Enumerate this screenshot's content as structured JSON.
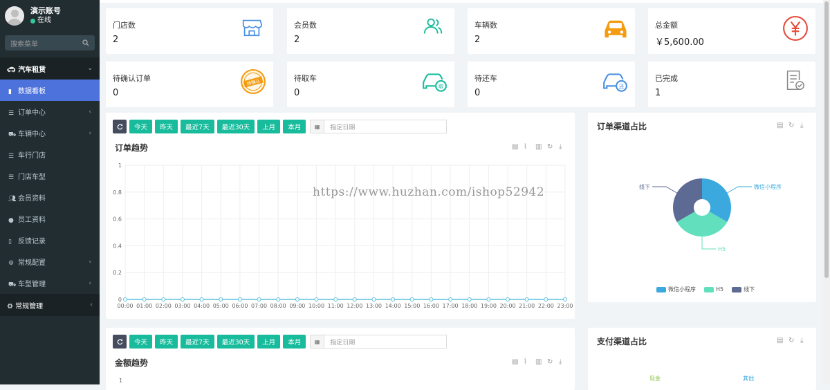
{
  "user": {
    "name": "演示账号",
    "status": "在线"
  },
  "search": {
    "placeholder": "搜索菜单"
  },
  "menu": {
    "group1": "汽车租赁",
    "items": [
      {
        "label": "数据看板",
        "icon": "bar-chart-icon",
        "active": true,
        "has_children": false
      },
      {
        "label": "订单中心",
        "icon": "list-icon",
        "has_children": true
      },
      {
        "label": "车辆中心",
        "icon": "car-icon",
        "has_children": true
      },
      {
        "label": "车行门店",
        "icon": "list-icon",
        "has_children": false
      },
      {
        "label": "门店车型",
        "icon": "list-icon",
        "has_children": false
      },
      {
        "label": "会员资料",
        "icon": "users-icon",
        "has_children": false
      },
      {
        "label": "员工资料",
        "icon": "user-icon",
        "has_children": false
      },
      {
        "label": "反馈记录",
        "icon": "book-icon",
        "has_children": false
      },
      {
        "label": "常规配置",
        "icon": "gear-icon",
        "has_children": true
      },
      {
        "label": "车型管理",
        "icon": "car-icon",
        "has_children": true
      }
    ],
    "group2": "常规管理"
  },
  "stats": [
    {
      "label": "门店数",
      "value": "2",
      "icon": "store-icon",
      "color": "#4a90e2"
    },
    {
      "label": "会员数",
      "value": "2",
      "icon": "members-icon",
      "color": "#18bc9c"
    },
    {
      "label": "车辆数",
      "value": "2",
      "icon": "car-icon",
      "color": "#f39c12"
    },
    {
      "label": "总金额",
      "value": "￥5,600.00",
      "icon": "yen-icon",
      "color": "#e74c3c"
    },
    {
      "label": "待确认订单",
      "value": "0",
      "icon": "pending-stamp-icon",
      "color": "#f39c12"
    },
    {
      "label": "待取车",
      "value": "0",
      "icon": "pickup-car-icon",
      "color": "#18bc9c"
    },
    {
      "label": "待还车",
      "value": "0",
      "icon": "return-car-icon",
      "color": "#4a90e2"
    },
    {
      "label": "已完成",
      "value": "1",
      "icon": "completed-doc-icon",
      "color": "#888888"
    }
  ],
  "toolbar": {
    "buttons": [
      "今天",
      "昨天",
      "最近7天",
      "最近30天",
      "上月",
      "本月"
    ],
    "date_placeholder": "指定日期"
  },
  "order_trend": {
    "title": "订单趋势",
    "chart_data": {
      "type": "line",
      "x": [
        "00:00",
        "01:00",
        "02:00",
        "03:00",
        "04:00",
        "05:00",
        "06:00",
        "07:00",
        "08:00",
        "09:00",
        "10:00",
        "11:00",
        "12:00",
        "13:00",
        "14:00",
        "15:00",
        "16:00",
        "17:00",
        "18:00",
        "19:00",
        "20:00",
        "21:00",
        "22:00",
        "23:00"
      ],
      "y_ticks": [
        "0",
        "0.2",
        "0.4",
        "0.6",
        "0.8",
        "1"
      ],
      "series": [
        {
          "values": [
            0,
            0,
            0,
            0,
            0,
            0,
            0,
            0,
            0,
            0,
            0,
            0,
            0,
            0,
            0,
            0,
            0,
            0,
            0,
            0,
            0,
            0,
            0,
            0
          ]
        }
      ],
      "ylim": [
        0,
        1
      ],
      "color": "#5bc0de"
    }
  },
  "order_channel": {
    "title": "订单渠道占比",
    "chart_data": {
      "type": "pie",
      "categories": [
        "微信小程序",
        "H5",
        "线下"
      ],
      "values": [
        1,
        1,
        1
      ],
      "colors": [
        "#3ba9de",
        "#62e0bd",
        "#5d6a94"
      ]
    }
  },
  "amount_trend": {
    "title": "金额趋势",
    "y_top": "1"
  },
  "pay_channel": {
    "title": "支付渠道占比",
    "labels": [
      "现金",
      "其他"
    ]
  },
  "watermark": "https://www.huzhan.com/ishop52942"
}
